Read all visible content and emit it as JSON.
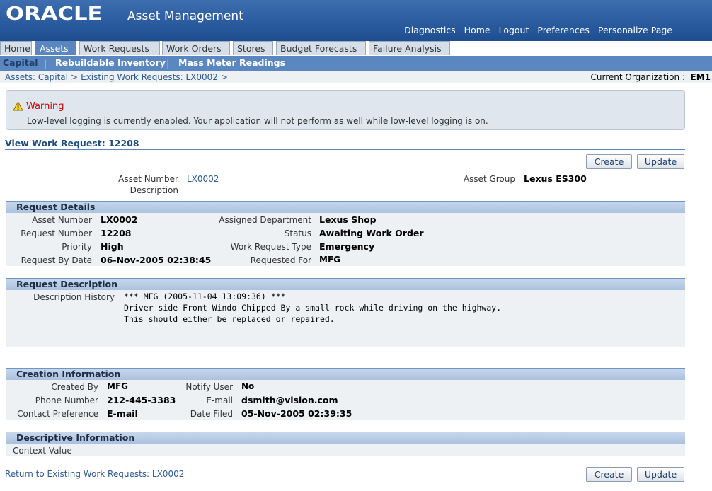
{
  "header": {
    "logo": "ORACLE",
    "app_title": "Asset Management",
    "global_links": [
      "Diagnostics",
      "Home",
      "Logout",
      "Preferences",
      "Personalize Page"
    ]
  },
  "tabs": [
    "Home",
    "Assets",
    "Work Requests",
    "Work Orders",
    "Stores",
    "Budget Forecasts",
    "Failure Analysis"
  ],
  "active_tab": "Assets",
  "subtabs": [
    "Capital",
    "Rebuildable Inventory",
    "Mass Meter Readings"
  ],
  "active_subtab": "Capital",
  "breadcrumb": [
    "Assets: Capital",
    "Existing Work Requests: LX0002"
  ],
  "current_org": {
    "label": "Current Organization :",
    "value": "EM1"
  },
  "warning": {
    "title": "Warning",
    "message": "Low-level logging is currently enabled. Your application will not perform as well while low-level logging is on."
  },
  "page_title": "View Work Request: 12208",
  "buttons": {
    "create": "Create",
    "update": "Update"
  },
  "asset": {
    "asset_number_label": "Asset Number",
    "asset_number": "LX0002",
    "description_label": "Description",
    "asset_group_label": "Asset Group",
    "asset_group": "Lexus ES300"
  },
  "request_details": {
    "title": "Request Details",
    "asset_number_label": "Asset Number",
    "asset_number": "LX0002",
    "request_number_label": "Request Number",
    "request_number": "12208",
    "priority_label": "Priority",
    "priority": "High",
    "request_by_date_label": "Request By Date",
    "request_by_date": "06-Nov-2005 02:38:45",
    "assigned_department_label": "Assigned Department",
    "assigned_department": "Lexus Shop",
    "status_label": "Status",
    "status": "Awaiting Work Order",
    "work_request_type_label": "Work Request Type",
    "work_request_type": "Emergency",
    "requested_for_label": "Requested For",
    "requested_for": "MFG"
  },
  "request_description": {
    "title": "Request Description",
    "history_label": "Description History",
    "history_lines": [
      "*** MFG (2005-11-04 13:09:36) ***",
      "Driver side Front Windo Chipped By a small rock while driving on the highway.",
      "This should either be replaced or repaired."
    ]
  },
  "creation_information": {
    "title": "Creation Information",
    "created_by_label": "Created By",
    "created_by": "MFG",
    "phone_number_label": "Phone Number",
    "phone_number": "212-445-3383",
    "contact_preference_label": "Contact Preference",
    "contact_preference": "E-mail",
    "notify_user_label": "Notify User",
    "notify_user": "No",
    "email_label": "E-mail",
    "email": "dsmith@vision.com",
    "date_filed_label": "Date Filed",
    "date_filed": "05-Nov-2005 02:39:35"
  },
  "descriptive_information": {
    "title": "Descriptive Information",
    "context_value_label": "Context Value"
  },
  "return_link": "Return to Existing Work Requests: LX0002",
  "colors": {
    "header_blue": "#2a5a9e",
    "tab_active": "#5b87c0",
    "warning_red": "#cc0000",
    "link": "#2d5a94"
  }
}
